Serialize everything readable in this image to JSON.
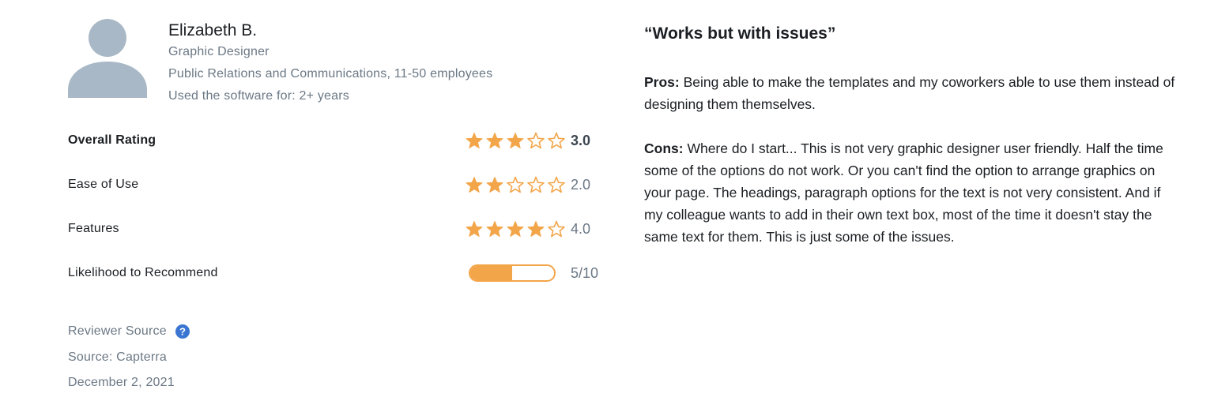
{
  "reviewer": {
    "name": "Elizabeth B.",
    "role": "Graphic Designer",
    "company": "Public Relations and Communications, 11-50 employees",
    "usage": "Used the software for: 2+ years",
    "avatar_icon": "user-silhouette-icon"
  },
  "ratings": [
    {
      "label": "Overall Rating",
      "stars": 3,
      "max": 5,
      "score": "3.0"
    },
    {
      "label": "Ease of Use",
      "stars": 2,
      "max": 5,
      "score": "2.0"
    },
    {
      "label": "Features",
      "stars": 4,
      "max": 5,
      "score": "4.0"
    }
  ],
  "recommend": {
    "label": "Likelihood to Recommend",
    "value": 5,
    "max": 10,
    "text": "5/10"
  },
  "source": {
    "label": "Reviewer Source",
    "help_icon": "question-circle-icon",
    "value": "Source: Capterra",
    "date": "December 2, 2021"
  },
  "review": {
    "title": "“Works but with issues”",
    "pros_label": "Pros:",
    "pros_text": " Being able to make the templates and my coworkers able to use them instead of designing them themselves.",
    "cons_label": "Cons:",
    "cons_text": " Where do I start... This is not very graphic designer user friendly. Half the time some of the options do not work. Or you can't find the option to arrange graphics on your page. The headings, paragraph options for the text is not very consistent. And if my colleague wants to add in their own text box, most of the time it doesn't stay the same text for them. This is just some of the issues."
  },
  "colors": {
    "star": "#f3a549",
    "avatar": "#a9b8c6",
    "help_icon": "#3a76d1",
    "muted_text": "#6b7885"
  }
}
